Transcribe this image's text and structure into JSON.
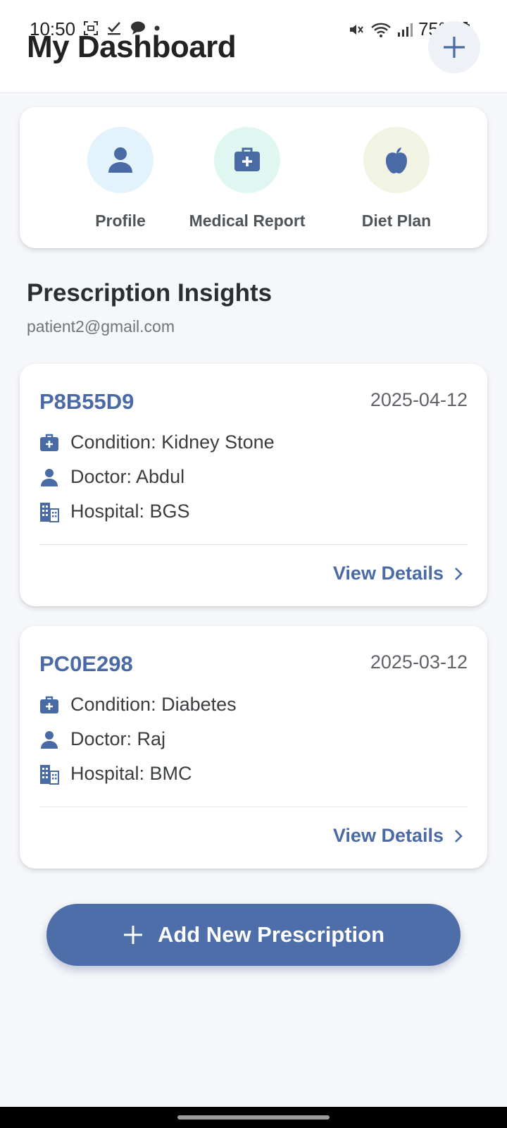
{
  "status_bar": {
    "time": "10:50",
    "battery": "75%",
    "left_icons": [
      "screenshot-icon",
      "check-icon",
      "chat-icon",
      "dot-icon"
    ],
    "right_icons": [
      "mute-icon",
      "wifi-icon",
      "signal-icon",
      "battery-icon"
    ]
  },
  "header": {
    "title": "My Dashboard",
    "add_icon": "plus-icon"
  },
  "quick_actions": [
    {
      "label": "Profile",
      "icon": "person-icon",
      "bg": "#e3f3fc"
    },
    {
      "label": "Medical Report",
      "icon": "medkit-icon",
      "bg": "#e0f7f1"
    },
    {
      "label": "Diet Plan",
      "icon": "apple-icon",
      "bg": "#f1f4e3"
    }
  ],
  "section": {
    "title": "Prescription Insights",
    "subtitle": "patient2@gmail.com"
  },
  "prescriptions": [
    {
      "id": "P8B55D9",
      "date": "2025-04-12",
      "condition": "Condition: Kidney Stone",
      "doctor": "Doctor: Abdul",
      "hospital": "Hospital: BGS",
      "action": "View Details"
    },
    {
      "id": "PC0E298",
      "date": "2025-03-12",
      "condition": "Condition: Diabetes",
      "doctor": "Doctor: Raj",
      "hospital": "Hospital: BMC",
      "action": "View Details"
    }
  ],
  "add_button": {
    "label": "Add New Prescription"
  },
  "colors": {
    "accent": "#4a6aa5",
    "button": "#4d6ea8",
    "background": "#f5f7fa"
  }
}
